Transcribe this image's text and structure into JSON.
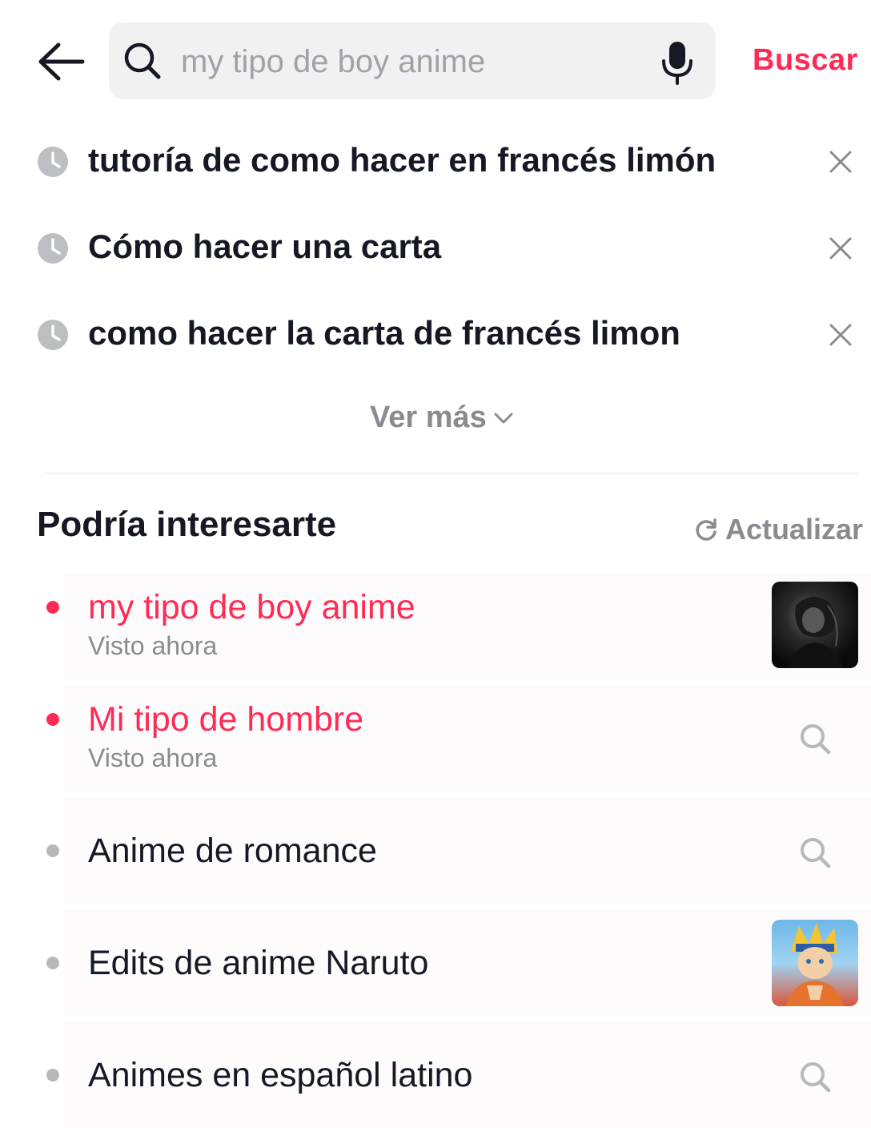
{
  "header": {
    "search_placeholder": "my tipo de boy anime",
    "search_button_label": "Buscar"
  },
  "history": {
    "items": [
      {
        "text": "tutoría de como hacer en francés limón"
      },
      {
        "text": "Cómo hacer una carta"
      },
      {
        "text": "como hacer la carta de francés limon"
      }
    ],
    "see_more_label": "Ver más"
  },
  "suggestions": {
    "title": "Podría interesarte",
    "refresh_label": "Actualizar",
    "items": [
      {
        "title": "my tipo de boy anime",
        "subtitle": "Visto ahora",
        "highlight": true,
        "trailing": "thumbnail-dark-anime-boy"
      },
      {
        "title": "Mi tipo de hombre",
        "subtitle": "Visto ahora",
        "highlight": true,
        "trailing": "search-icon"
      },
      {
        "title": "Anime de romance",
        "highlight": false,
        "trailing": "search-icon"
      },
      {
        "title": "Edits de anime Naruto",
        "highlight": false,
        "trailing": "thumbnail-naruto"
      },
      {
        "title": "Animes en español latino",
        "highlight": false,
        "trailing": "search-icon"
      }
    ]
  },
  "colors": {
    "accent": "#fe2c55",
    "text": "#161823",
    "muted": "#8a8b91",
    "search_bg": "#f1f1f2"
  }
}
